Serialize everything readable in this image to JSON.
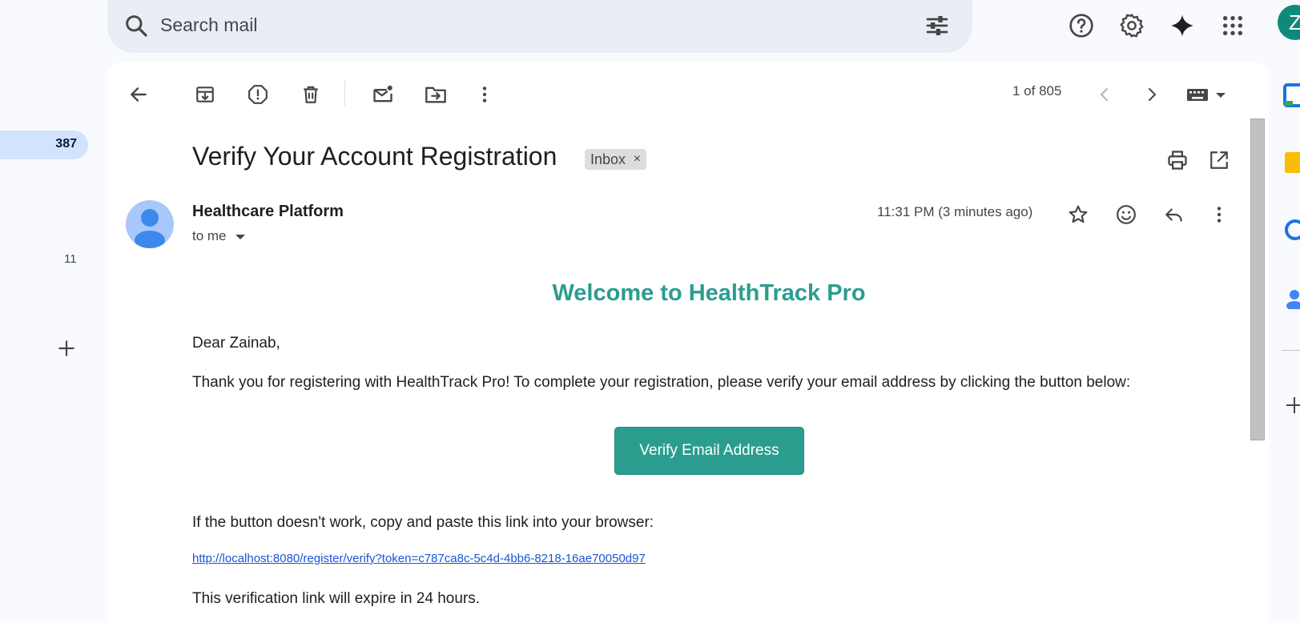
{
  "search": {
    "placeholder": "Search mail"
  },
  "top_avatar": {
    "initial": "Z",
    "color": "#0f8a7a"
  },
  "left_rail": {
    "inbox_count": "387",
    "other_count": "11"
  },
  "toolbar": {
    "pager": "1 of 805"
  },
  "email": {
    "subject": "Verify Your Account Registration",
    "label": "Inbox",
    "label_remove": "×",
    "sender": "Healthcare Platform",
    "recipient": "to me",
    "time": "11:31 PM (3 minutes ago)",
    "body": {
      "heading": "Welcome to HealthTrack Pro",
      "greeting": "Dear Zainab,",
      "intro": "Thank you for registering with HealthTrack Pro! To complete your registration, please verify your email address by clicking the button below:",
      "button": "Verify Email Address",
      "fallback": "If the button doesn't work, copy and paste this link into your browser:",
      "link": "http://localhost:8080/register/verify?token=c787ca8c-5c4d-4bb6-8218-16ae70050d97",
      "expiry": "This verification link will expire in 24 hours."
    }
  },
  "colors": {
    "accent": "#2a9d8f",
    "link": "#1a55d6",
    "selected": "#d3e3fd"
  },
  "icons": [
    "search-icon",
    "filter-icon",
    "help-icon",
    "settings-icon",
    "gemini-icon",
    "apps-icon",
    "back-icon",
    "archive-icon",
    "report-spam-icon",
    "delete-icon",
    "mark-unread-icon",
    "move-to-icon",
    "more-icon",
    "prev-icon",
    "next-icon",
    "keyboard-icon",
    "print-icon",
    "open-new-window-icon",
    "star-icon",
    "emoji-icon",
    "reply-icon",
    "plus-icon"
  ]
}
